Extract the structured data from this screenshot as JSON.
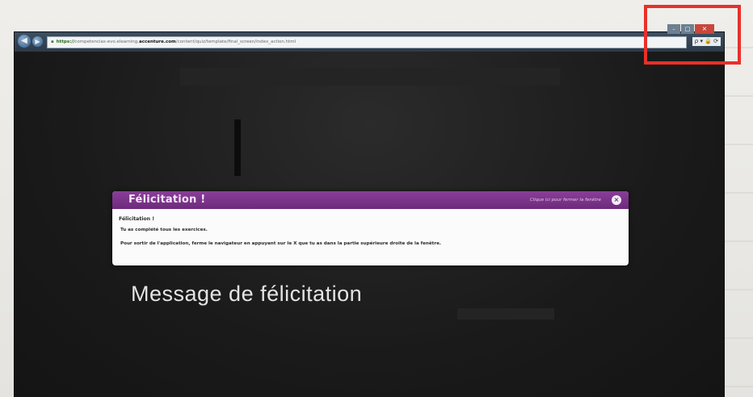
{
  "browser": {
    "url_prefix": "https://",
    "url_host_start": "competencias-evo.elearning.",
    "url_domain": "accenture.com",
    "url_path": "/content/quiz/template/final_screen/index_action.html",
    "tool_icons": "ρ ▾ 🔒 ⟳"
  },
  "dialog": {
    "title": "Félicitation !",
    "hint": "Clique ici pour fermer la fenêtre",
    "heading": "Félicitation !",
    "line1": "Tu as complété tous les exercices.",
    "line2": "Pour sortir de l'application, ferme le navigateur en appuyant sur le X que tu as dans la partie supérieure droite de la fenêtre."
  },
  "caption": "Message de félicitation",
  "colors": {
    "dialog_header": "#7a3389",
    "highlight": "#e8302a",
    "screen_bg": "#1c1c1c"
  }
}
